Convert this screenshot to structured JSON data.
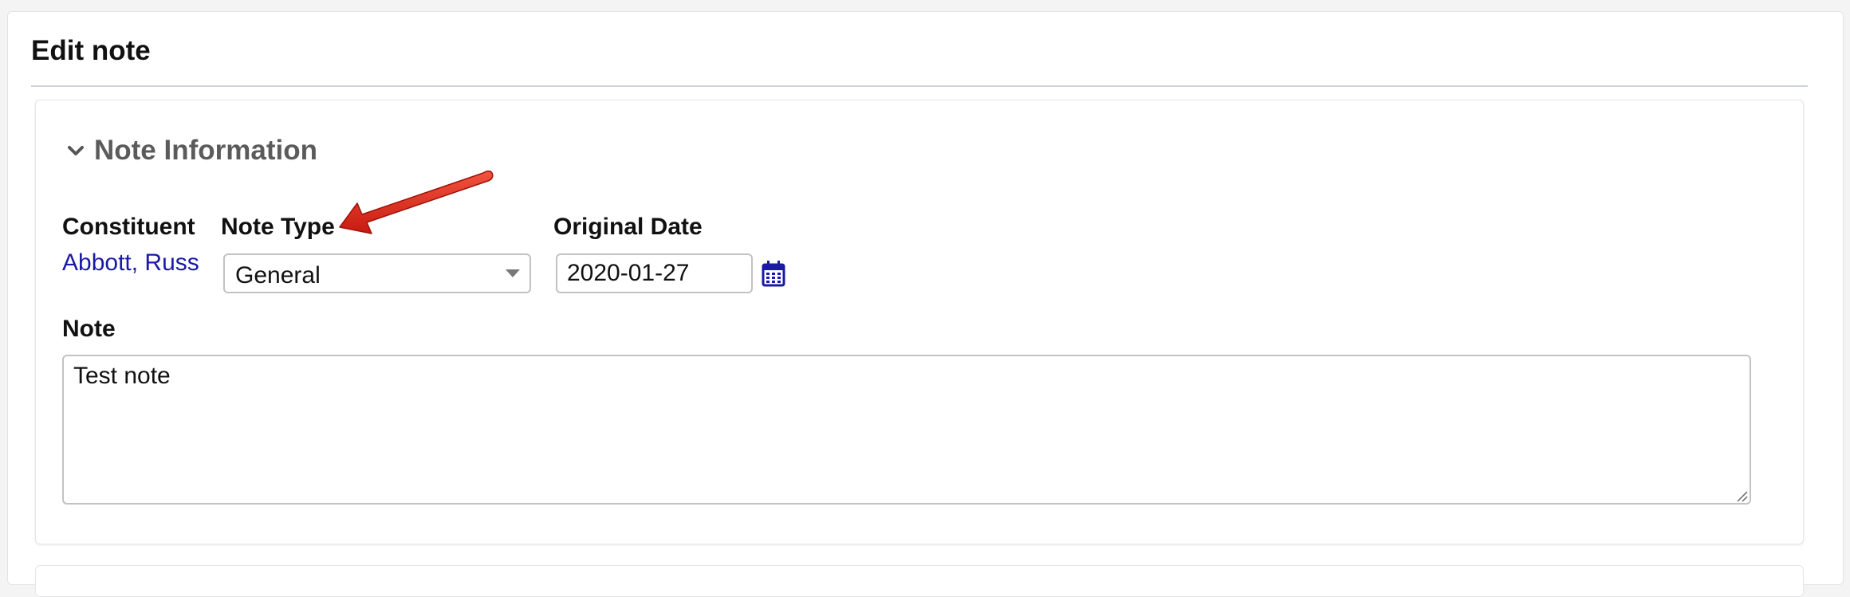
{
  "page": {
    "title": "Edit note"
  },
  "section": {
    "title": "Note Information",
    "expanded": true,
    "toggle_icon": "chevron-down-icon"
  },
  "fields": {
    "constituent": {
      "label": "Constituent",
      "value": "Abbott, Russ"
    },
    "note_type": {
      "label": "Note Type",
      "selected": "General"
    },
    "original_date": {
      "label": "Original Date",
      "value": "2020-01-27",
      "icon": "calendar-icon"
    },
    "note": {
      "label": "Note",
      "value": "Test note"
    }
  },
  "annotation": {
    "icon": "red-arrow-icon",
    "color": "#e0281e",
    "points_to": "Note Type"
  },
  "colors": {
    "link": "#1a1aa6",
    "section_title": "#5b5b5b",
    "divider": "#cdd4de"
  }
}
